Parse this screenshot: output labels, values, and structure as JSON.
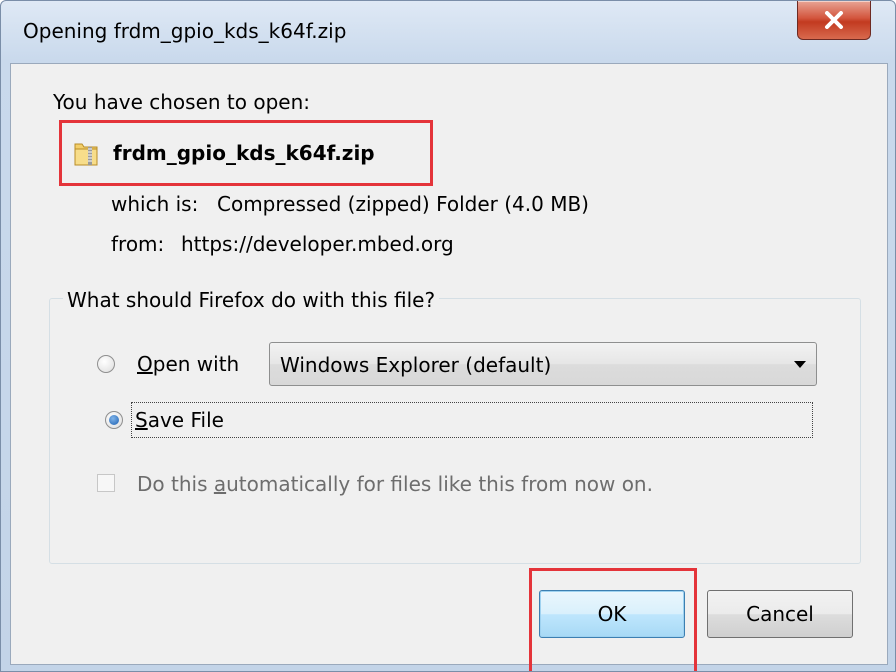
{
  "window": {
    "title": "Opening frdm_gpio_kds_k64f.zip",
    "close_icon": "close-icon"
  },
  "file": {
    "intro": "You have chosen to open:",
    "name": "frdm_gpio_kds_k64f.zip",
    "icon": "zip-folder-icon",
    "type_label": "which is:",
    "type_value": "Compressed (zipped) Folder (4.0 MB)",
    "from_label": "from:",
    "from_value": "https://developer.mbed.org"
  },
  "action_group": {
    "legend": "What should Firefox do with this file?",
    "open_with": {
      "access_key": "O",
      "label_rest": "pen with",
      "selected": false,
      "app_select": "Windows Explorer (default)"
    },
    "save_file": {
      "access_key": "S",
      "label_rest": "ave File",
      "selected": true
    },
    "auto_checkbox": {
      "label_before": "Do this ",
      "access_key": "a",
      "label_after": "utomatically for files like this from now on.",
      "checked": false,
      "enabled": false
    }
  },
  "buttons": {
    "ok": "OK",
    "cancel": "Cancel"
  },
  "colors": {
    "highlight": "#e4343a",
    "radio_selected": "#1c5fb0"
  }
}
